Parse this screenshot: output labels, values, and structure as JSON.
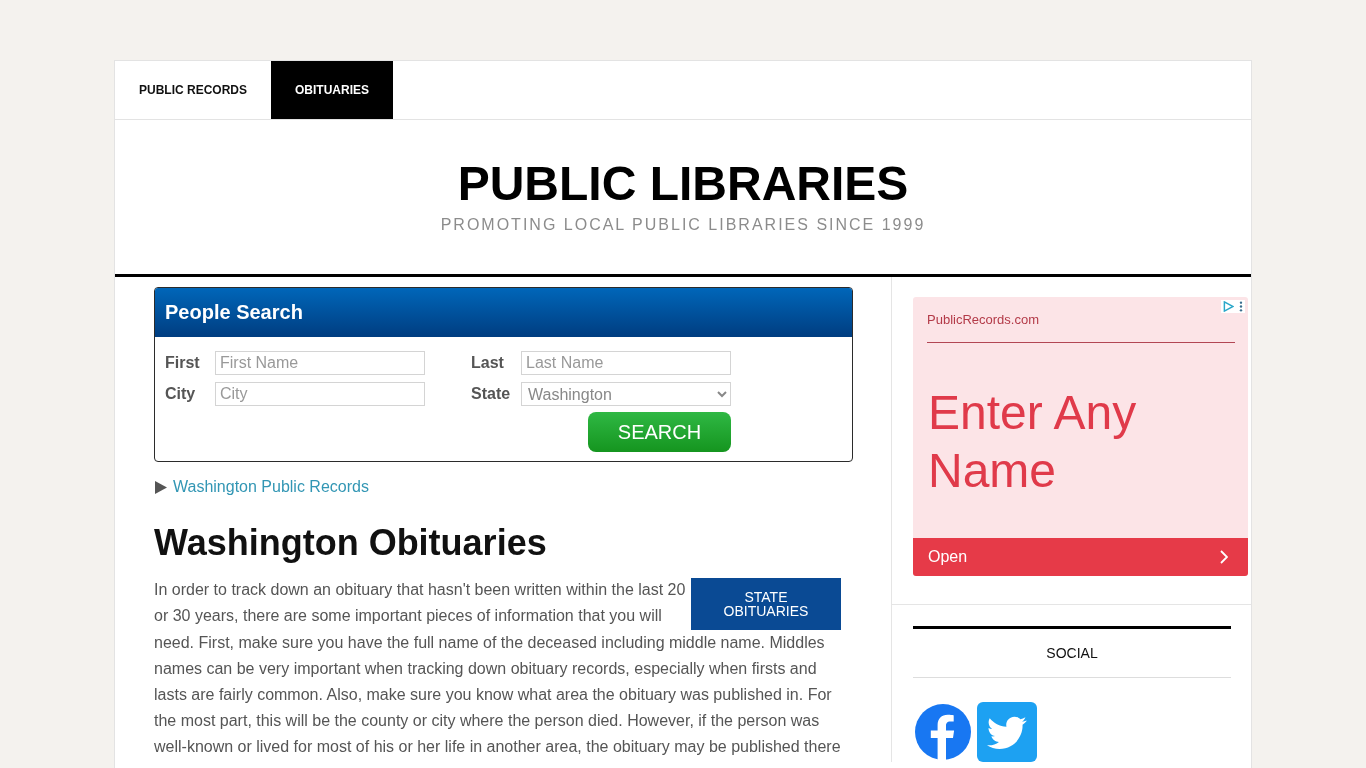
{
  "nav": {
    "tabs": [
      {
        "label": "PUBLIC RECORDS",
        "selected": false
      },
      {
        "label": "OBITUARIES",
        "selected": true
      }
    ]
  },
  "header": {
    "title": "PUBLIC LIBRARIES",
    "tagline": "PROMOTING LOCAL PUBLIC LIBRARIES SINCE 1999"
  },
  "people_search": {
    "title": "People Search",
    "fields": [
      {
        "label": "First",
        "kind": "text",
        "placeholder": "First Name"
      },
      {
        "label": "Last",
        "kind": "text",
        "placeholder": "Last Name"
      },
      {
        "label": "City",
        "kind": "text",
        "placeholder": "City"
      },
      {
        "label": "State",
        "kind": "select",
        "value": "Washington"
      }
    ],
    "button": "SEARCH"
  },
  "records_link": {
    "label": "Washington Public Records",
    "expanded": false
  },
  "article": {
    "heading": "Washington Obituaries",
    "button": "STATE OBITUARIES",
    "paragraph_beside_button": "In order to track down an obituary that hasn't been written within the last 20 or 30 years, there are some important pieces of information that you will",
    "paragraph": "need. First, make sure you have the full name of the deceased including middle name. Middles names can be very important when tracking down obituary records, especially when firsts and lasts are fairly common. Also, make sure you know what area the obituary was published in. For the most part, this will be the county or city where the person died. However, if the person was well-known or lived for most of his or her life in another area, the obituary may be published there"
  },
  "sidebar": {
    "ad": {
      "advertiser": "PublicRecords.com",
      "headline": "Enter Any Name",
      "cta": "Open"
    },
    "social": {
      "title": "SOCIAL"
    }
  }
}
